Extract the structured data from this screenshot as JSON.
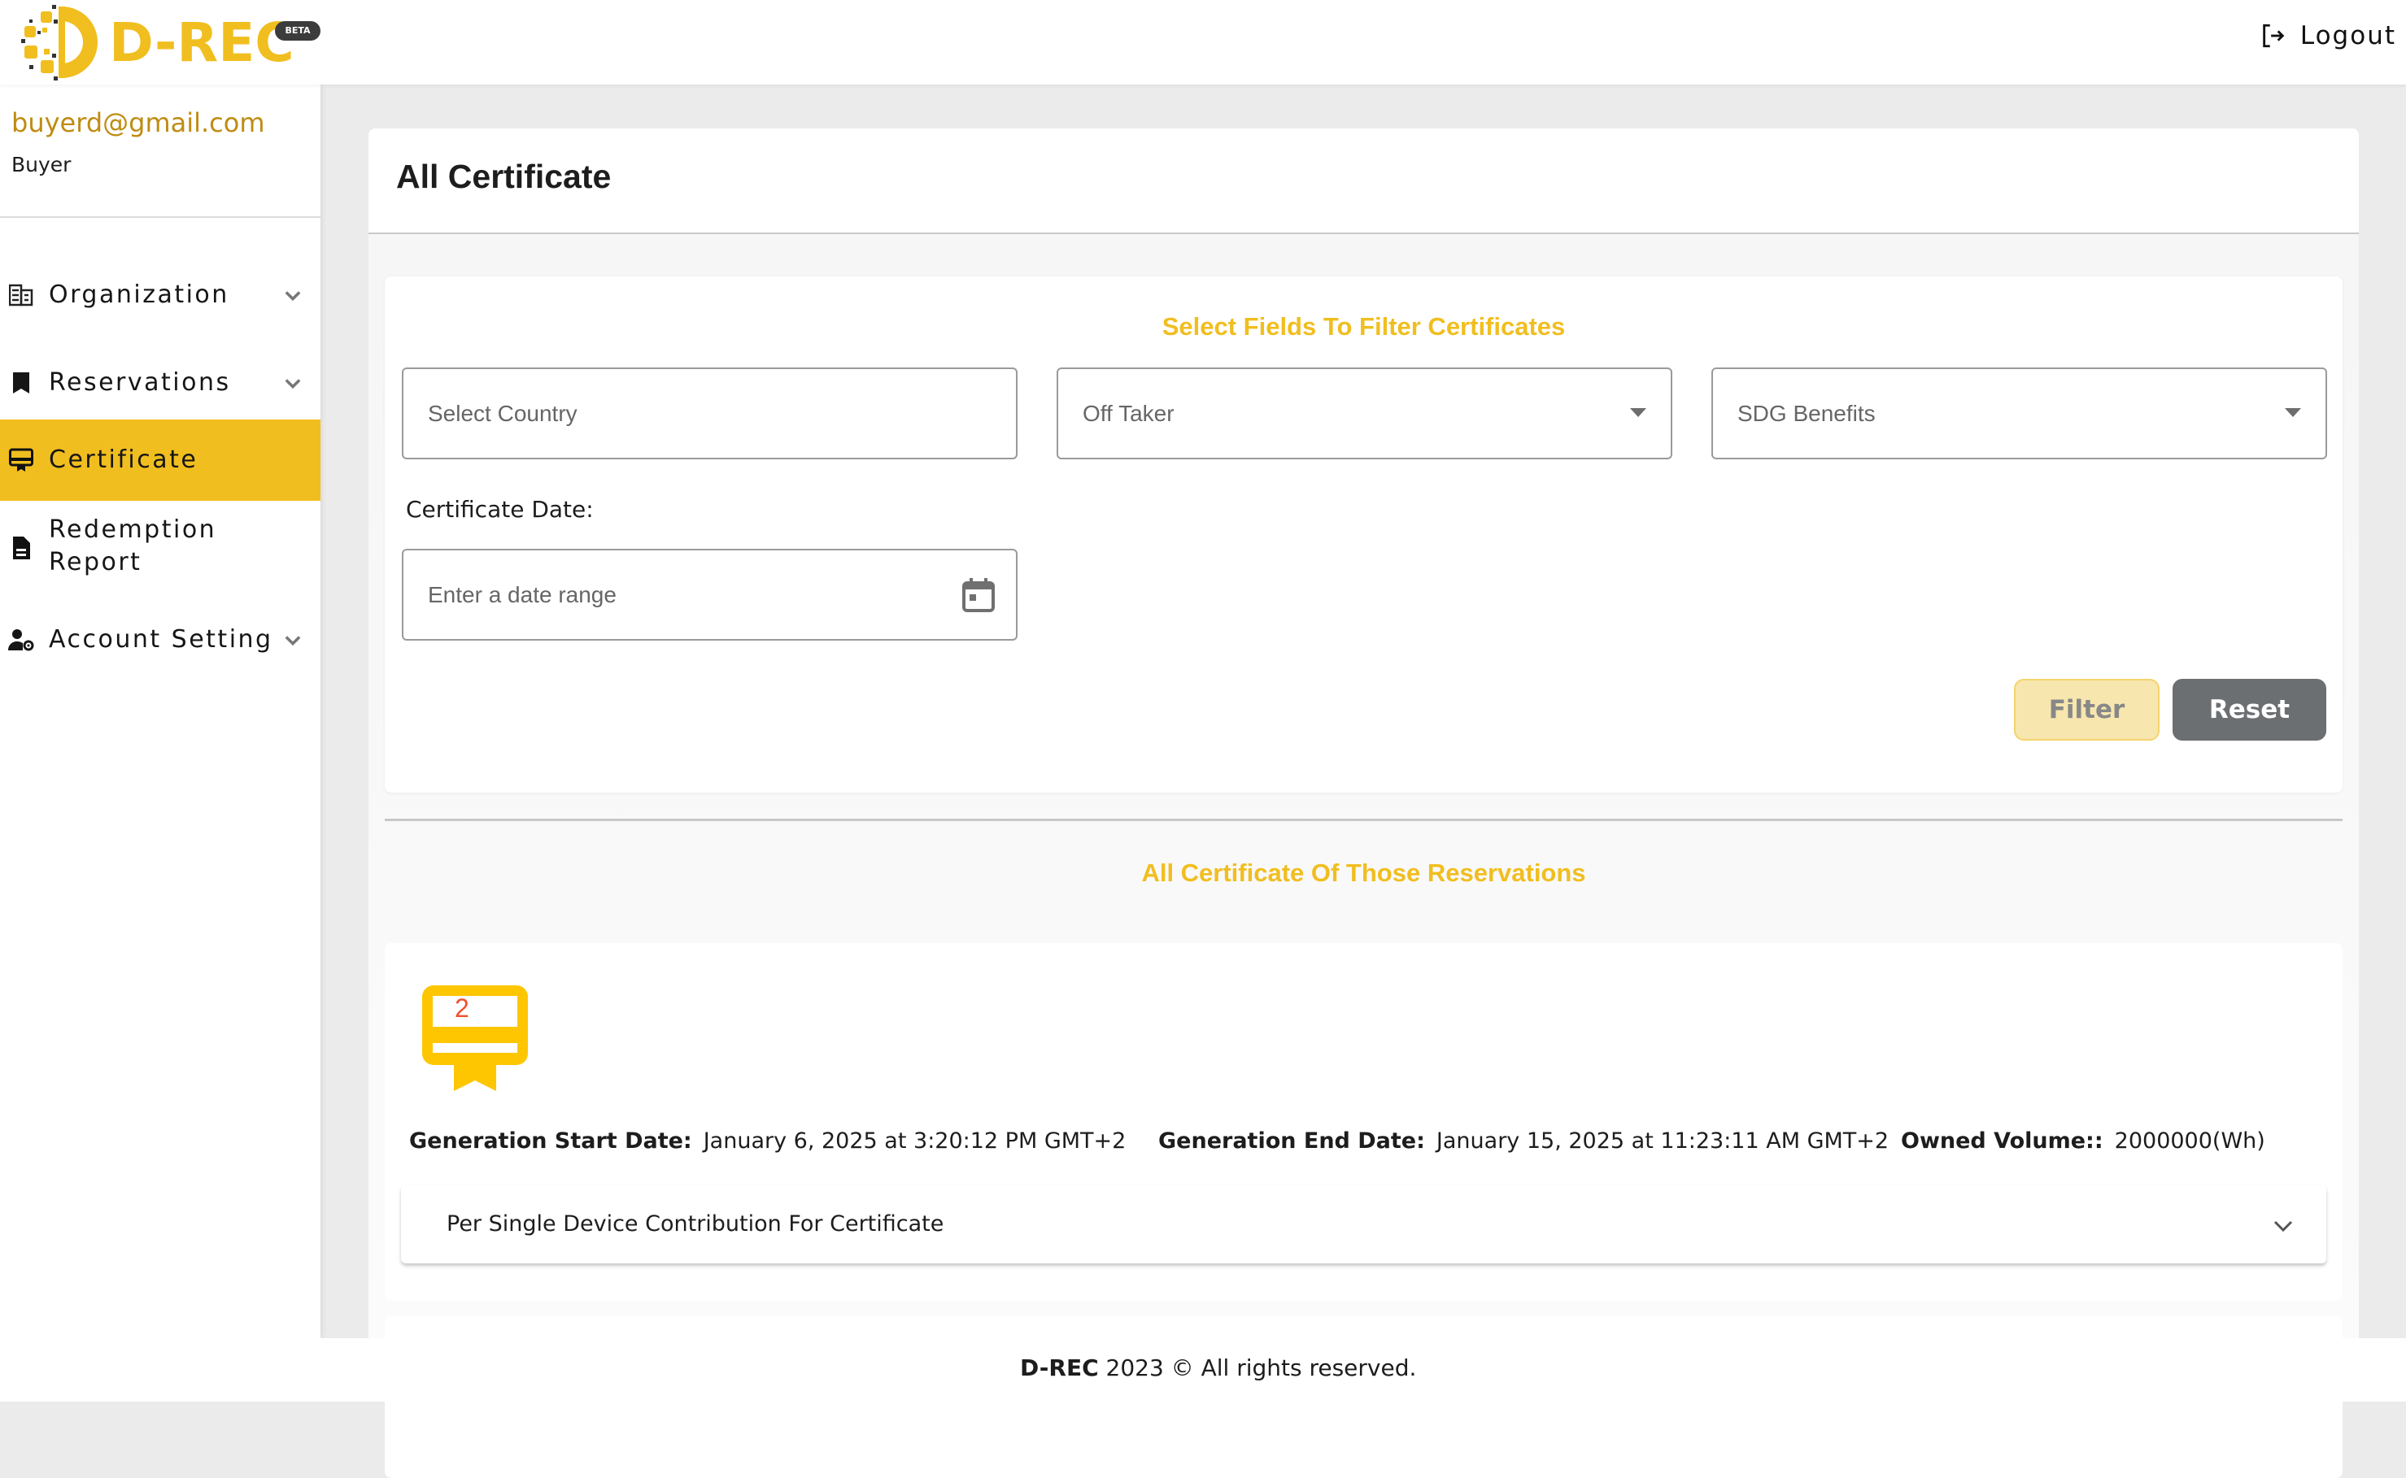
{
  "header": {
    "logo_text": "D-REC",
    "beta_badge": "BETA",
    "logout_label": "Logout",
    "brand_color": "#f1be1f"
  },
  "user": {
    "email": "buyerd@gmail.com",
    "role": "Buyer"
  },
  "sidebar": {
    "items": [
      {
        "label": "Organization",
        "icon": "building-icon",
        "expandable": true,
        "active": false
      },
      {
        "label": "Reservations",
        "icon": "bookmark-icon",
        "expandable": true,
        "active": false
      },
      {
        "label": "Certificate",
        "icon": "certificate-icon",
        "expandable": false,
        "active": true
      },
      {
        "label_line1": "Redemption",
        "label_line2": "Report",
        "icon": "document-icon",
        "expandable": false,
        "active": false
      },
      {
        "label": "Account Setting",
        "icon": "user-gear-icon",
        "expandable": true,
        "active": false
      }
    ]
  },
  "main": {
    "title": "All Certificate",
    "filter": {
      "heading": "Select Fields To Filter Certificates",
      "country_placeholder": "Select Country",
      "offtaker_placeholder": "Off Taker",
      "sdg_placeholder": "SDG Benefits",
      "date_label": "Certificate Date:",
      "date_placeholder": "Enter a date range",
      "filter_button": "Filter",
      "reset_button": "Reset"
    },
    "list_heading": "All Certificate Of Those Reservations",
    "certificates": [
      {
        "number": "2",
        "start_label": "Generation Start Date:",
        "start_value": "January 6, 2025 at 3:20:12 PM GMT+2",
        "end_label": "Generation End Date:",
        "end_value": "January 15, 2025 at 11:23:11 AM GMT+2",
        "volume_label": "Owned Volume::",
        "volume_value": "2000000(Wh)",
        "accordion_label": "Per Single Device Contribution For Certificate"
      }
    ]
  },
  "footer": {
    "brand": "D-REC",
    "text": " 2023 © All rights reserved."
  }
}
